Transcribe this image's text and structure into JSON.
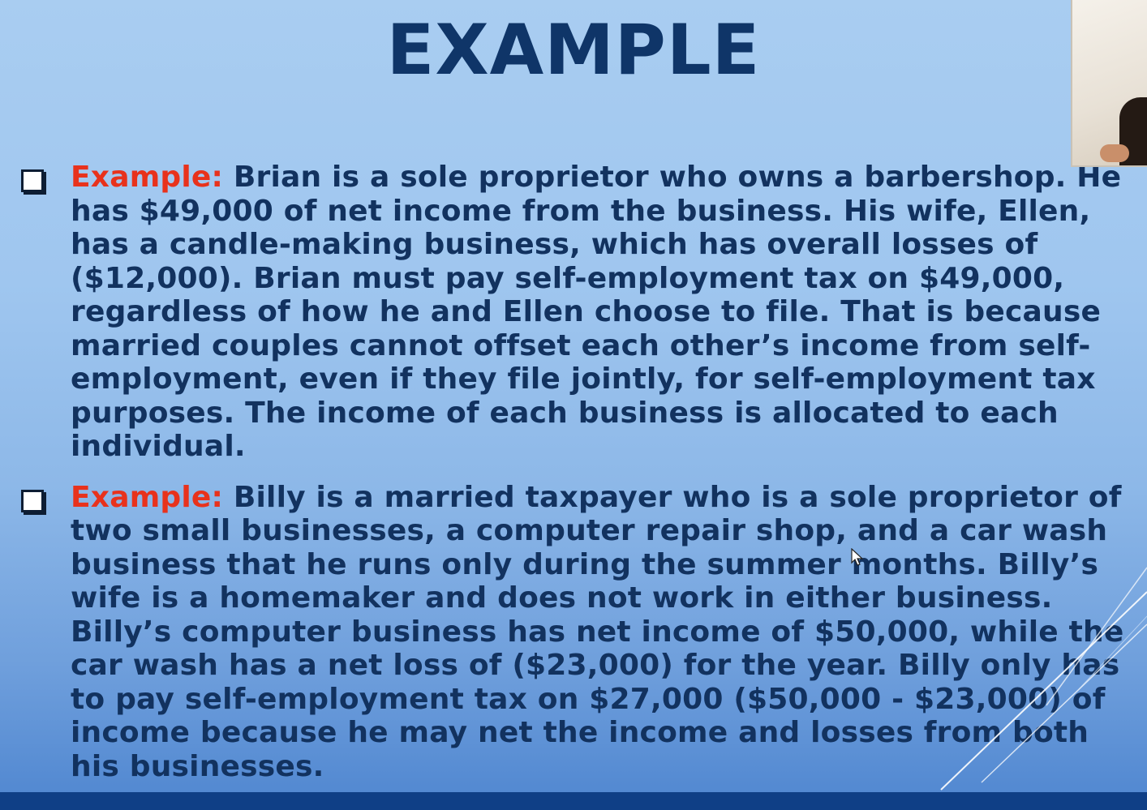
{
  "slide": {
    "title": "EXAMPLE",
    "bullets": [
      {
        "label": "Example:",
        "text": " Brian is a sole proprietor who owns a barbershop. He has $49,000 of net income from the business. His wife, Ellen, has a candle-making business, which has overall losses of ($12,000). Brian must pay self-employment tax on $49,000, regardless of how he and Ellen choose to file. That is because married couples cannot offset each other’s income from self-employment, even if they file jointly, for self-employment tax purposes. The income of each business is allocated to each individual."
      },
      {
        "label": "Example:",
        "text": " Billy is a married taxpayer who is a sole proprietor of two small businesses, a computer repair shop, and a car wash business that he runs only during the summer months. Billy’s wife is a homemaker and does not work in either business. Billy’s computer business has net income of $50,000, while the car wash has a net loss of ($23,000) for the year. Billy only has to pay self-employment tax on $27,000 ($50,000 - $23,000) of income because he may net the income and losses from both his businesses."
      }
    ]
  },
  "colors": {
    "title": "#0f3568",
    "label": "#e8321c",
    "body_text": "#12325f",
    "bottom_bar": "#0f3f86"
  },
  "icons": {
    "bullet": "checkbox-bullet-icon",
    "pointer": "mouse-cursor-icon"
  }
}
